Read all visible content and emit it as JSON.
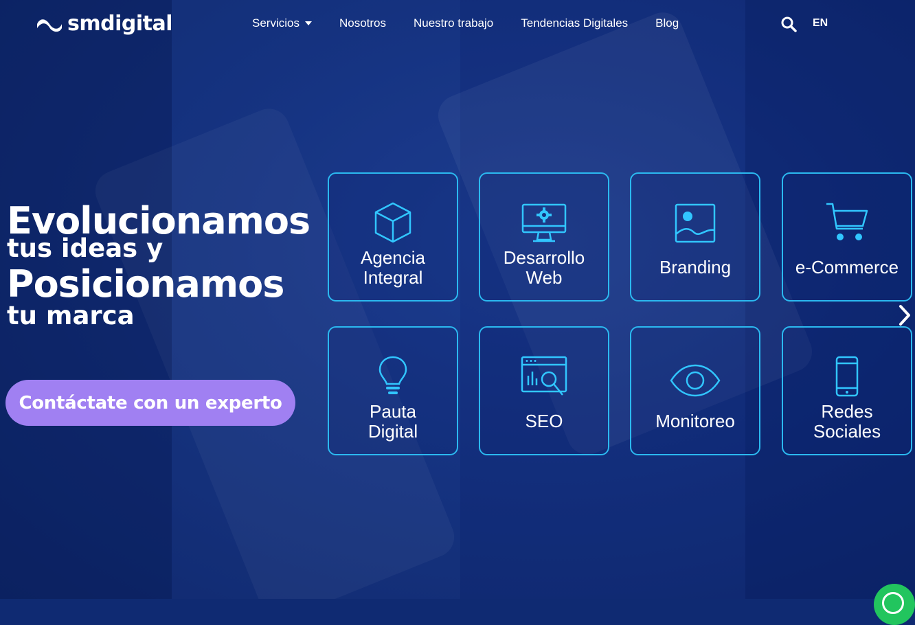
{
  "brand": {
    "name": "smdigital"
  },
  "nav": {
    "items": [
      {
        "label": "Servicios",
        "has_dropdown": true
      },
      {
        "label": "Nosotros"
      },
      {
        "label": "Nuestro trabajo"
      },
      {
        "label": "Tendencias Digitales"
      },
      {
        "label": "Blog"
      }
    ],
    "language": "EN"
  },
  "hero": {
    "line1": "Evolucionamos",
    "line2": "tus ideas y",
    "line3": "Posicionamos",
    "line4": "tu marca",
    "cta_label": "Contáctate con un experto"
  },
  "services": [
    {
      "label": "Agencia\nIntegral",
      "icon": "cube-icon"
    },
    {
      "label": "Desarrollo\nWeb",
      "icon": "monitor-gear-icon"
    },
    {
      "label": "Branding",
      "icon": "image-icon"
    },
    {
      "label": "e-Commerce",
      "icon": "shopping-cart-icon"
    },
    {
      "label": "Pauta\nDigital",
      "icon": "lightbulb-icon"
    },
    {
      "label": "SEO",
      "icon": "browser-search-icon"
    },
    {
      "label": "Monitoreo",
      "icon": "eye-icon"
    },
    {
      "label": "Redes\nSociales",
      "icon": "smartphone-icon"
    }
  ],
  "colors": {
    "background": "#13307f",
    "card_border": "#2bb9f0",
    "icon_color": "#31c6ff",
    "cta_background": "#a080f2",
    "whatsapp": "#22c55e"
  }
}
